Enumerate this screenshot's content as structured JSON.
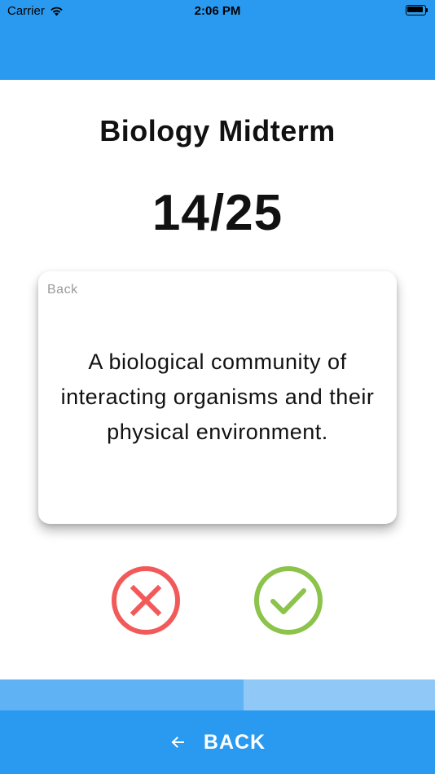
{
  "status_bar": {
    "carrier": "Carrier",
    "time": "2:06 PM",
    "wifi_icon": "wifi-icon",
    "battery_icon": "battery-full-icon"
  },
  "quiz": {
    "title": "Biology Midterm",
    "progress_text": "14/25",
    "progress_fraction": 0.56
  },
  "card": {
    "side_label": "Back",
    "text": "A biological community of interacting organisms and their physical environment."
  },
  "actions": {
    "wrong_icon": "x-circle-icon",
    "right_icon": "check-circle-icon"
  },
  "navigation": {
    "back_label": "BACK",
    "back_icon": "arrow-left-icon"
  },
  "colors": {
    "primary": "#2a9af0",
    "wrong": "#f25a5a",
    "right": "#8cc34a",
    "progress_fill": "#5fb2f3",
    "progress_track": "#90c9f7"
  }
}
